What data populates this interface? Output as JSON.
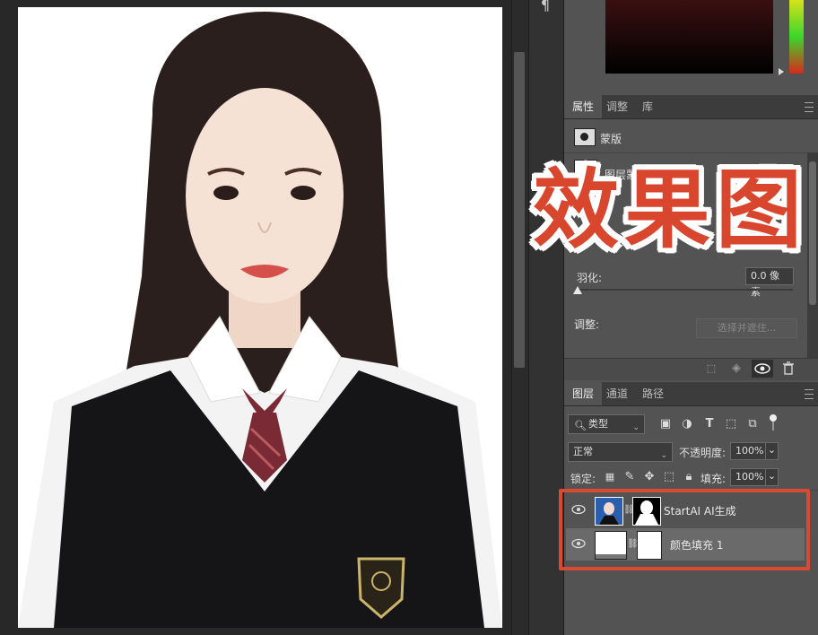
{
  "properties_panel": {
    "tabs": [
      "属性",
      "调整",
      "库"
    ],
    "mask_label": "蒙版",
    "layer_mask_label": "图层蒙版",
    "feather_label": "羽化:",
    "feather_value": "0.0 像素",
    "adjust_label": "调整:",
    "select_and_mask_button": "选择并遮住..."
  },
  "overlay": {
    "text": "效果图",
    "color": "#d9462e"
  },
  "layers_panel": {
    "tabs": [
      "图层",
      "通道",
      "路径"
    ],
    "filter_kind": "类型",
    "blend_mode": "正常",
    "opacity_label": "不透明度:",
    "opacity_value": "100%",
    "lock_label": "锁定:",
    "fill_label": "填充:",
    "fill_value": "100%",
    "layers": [
      {
        "name": "StartAI AI生成",
        "visible": true
      },
      {
        "name": "颜色填充 1",
        "visible": true
      }
    ],
    "highlight_color": "#d94a30"
  },
  "icons": [
    "paragraph-icon",
    "mask-icon",
    "eye-icon",
    "trash-icon",
    "search-icon"
  ]
}
